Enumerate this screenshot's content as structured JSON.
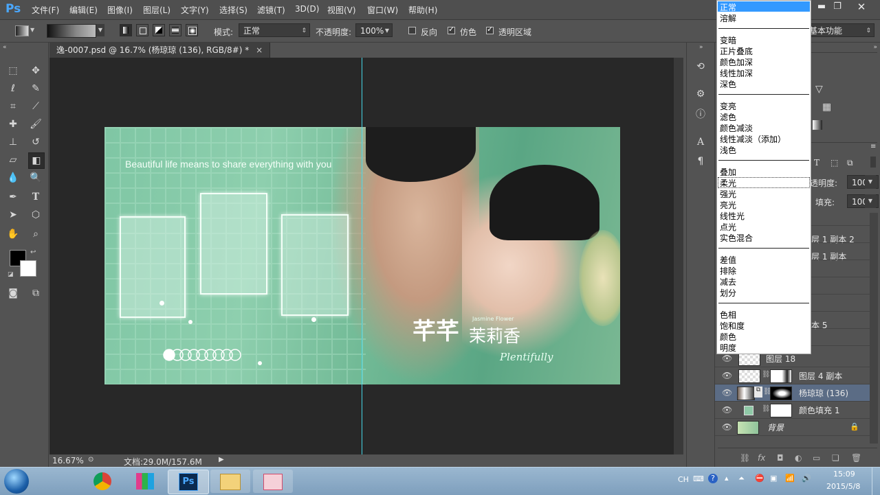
{
  "app": {
    "logo": "Ps",
    "menu": [
      "文件(F)",
      "编辑(E)",
      "图像(I)",
      "图层(L)",
      "文字(Y)",
      "选择(S)",
      "滤镜(T)",
      "3D(D)",
      "视图(V)",
      "窗口(W)",
      "帮助(H)"
    ]
  },
  "options": {
    "mode_label": "模式:",
    "mode_value": "正常",
    "opacity_label": "不透明度:",
    "opacity_value": "100%",
    "reverse_label": "反向",
    "dither_label": "仿色",
    "transparency_label": "透明区域",
    "workspace_value": "基本功能"
  },
  "document": {
    "tab_title": "逸-0007.psd @ 16.7% (杨琼琼 (136), RGB/8#) *",
    "close": "×"
  },
  "artwork": {
    "tagline": "Beautiful life means to share everything with you",
    "title_main": "芊芊",
    "title_sub": "茉莉香",
    "title_small": "Jasmine Flower",
    "script_text": "Plentifully"
  },
  "status": {
    "zoom": "16.67%",
    "doc_size": "文档:29.0M/157.6M"
  },
  "blend_modes": {
    "groups": [
      [
        "正常",
        "溶解"
      ],
      [
        "变暗",
        "正片叠底",
        "颜色加深",
        "线性加深",
        "深色"
      ],
      [
        "变亮",
        "滤色",
        "颜色减淡",
        "线性减淡（添加）",
        "浅色"
      ],
      [
        "叠加",
        "柔光",
        "强光",
        "亮光",
        "线性光",
        "点光",
        "实色混合"
      ],
      [
        "差值",
        "排除",
        "减去",
        "划分"
      ],
      [
        "色相",
        "饱和度",
        "颜色",
        "明度"
      ]
    ],
    "selected": "正常",
    "hovered": "柔光"
  },
  "layers_panel": {
    "opacity_label": "透明度:",
    "opacity_value": "100%",
    "fill_label": "填充:",
    "fill_value": "100%",
    "partial_rows": [
      "层 1 副本 2",
      "层 1 副本",
      "本 5"
    ],
    "rows": [
      {
        "name": "图层 18",
        "kind": "transparent"
      },
      {
        "name": "图层 4 副本",
        "kind": "mask"
      },
      {
        "name": "杨琼琼 (136)",
        "kind": "photo",
        "selected": true
      },
      {
        "name": "颜色填充 1",
        "kind": "fill"
      },
      {
        "name": "背景",
        "kind": "background",
        "locked": true
      }
    ]
  },
  "taskbar": {
    "lang": "CH",
    "time": "15:09",
    "date": "2015/5/8"
  },
  "colors": {
    "accent": "#4aa8ff",
    "guide": "#44d7e8",
    "selection": "#3399ff"
  }
}
